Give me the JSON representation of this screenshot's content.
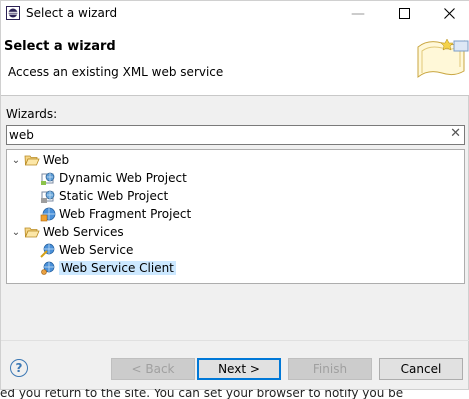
{
  "window": {
    "title": "Select a wizard",
    "minimize_glyph": "—",
    "maximize_glyph": "☐",
    "close_glyph": "✕"
  },
  "header": {
    "title": "Select a wizard",
    "description": "Access an existing XML web service"
  },
  "wizards_label": "Wizards:",
  "filter": {
    "value": "web",
    "clear_glyph": "✕"
  },
  "tree": [
    {
      "label": "Web",
      "level": 0,
      "expanded": true,
      "icon": "folder-open-icon"
    },
    {
      "label": "Dynamic Web Project",
      "level": 1,
      "icon": "dynamic-web-project-icon"
    },
    {
      "label": "Static Web Project",
      "level": 1,
      "icon": "static-web-project-icon"
    },
    {
      "label": "Web Fragment Project",
      "level": 1,
      "icon": "web-fragment-project-icon"
    },
    {
      "label": "Web Services",
      "level": 0,
      "expanded": true,
      "icon": "folder-open-icon"
    },
    {
      "label": "Web Service",
      "level": 1,
      "icon": "web-service-icon"
    },
    {
      "label": "Web Service Client",
      "level": 1,
      "icon": "web-service-client-icon",
      "selected": true
    }
  ],
  "buttons": {
    "back": "< Back",
    "next": "Next >",
    "finish": "Finish",
    "cancel": "Cancel"
  },
  "help_glyph": "?",
  "background_text": "ed you return to the site. You can set your browser to notify you be",
  "colors": {
    "selection": "#cce8ff",
    "default_button_border": "#0078d7",
    "folder": "#e8b84a"
  }
}
